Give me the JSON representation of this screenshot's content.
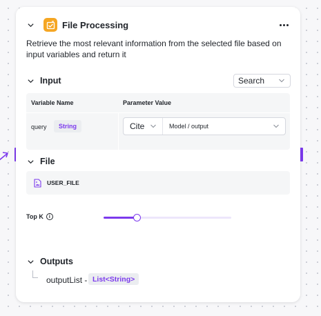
{
  "node": {
    "title": "File Processing",
    "description": "Retrieve the most relevant information from the selected file based on input variables and return it",
    "icon": "file-processing-icon",
    "accent_color": "#f5a623"
  },
  "input": {
    "section_label": "Input",
    "mode_select": "Search",
    "columns": [
      "Variable Name",
      "Parameter Value"
    ],
    "rows": [
      {
        "name": "query",
        "type": "String",
        "source": "Cite",
        "value": "Model / output"
      }
    ]
  },
  "file": {
    "section_label": "File",
    "file_name": "USER_FILE"
  },
  "top_k": {
    "label": "Top K",
    "info_icon": "i",
    "slider_fraction": 0.26
  },
  "outputs": {
    "section_label": "Outputs",
    "items": [
      {
        "name": "outputList -",
        "type": "List<String>"
      }
    ]
  },
  "colors": {
    "port": "#7c3aed",
    "type_text": "#7c3aed"
  }
}
